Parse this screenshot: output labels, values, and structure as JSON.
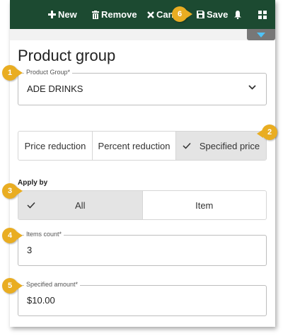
{
  "toolbar": {
    "new_label": "New",
    "remove_label": "Remove",
    "cancel_label": "Can",
    "save_label": "Save"
  },
  "page": {
    "title": "Product group"
  },
  "product_group": {
    "label": "Product Group*",
    "value": "ADE DRINKS"
  },
  "reduction_type": {
    "options": [
      "Price reduction",
      "Percent reduction",
      "Specified price"
    ],
    "selected": "Specified price"
  },
  "apply_by": {
    "heading": "Apply by",
    "options": [
      "All",
      "Item"
    ],
    "selected": "All"
  },
  "items_count": {
    "label": "Items count*",
    "value": "3"
  },
  "specified_amount": {
    "label": "Specified amount*",
    "value": "$10.00"
  },
  "callouts": [
    "1",
    "2",
    "3",
    "4",
    "5",
    "6"
  ],
  "colors": {
    "toolbar_bg": "#1c4a31",
    "callout": "#e9ad22",
    "collapse_tab": "#777777",
    "collapse_arrow": "#4fc3f7",
    "selected_segment": "#e4e4e4"
  },
  "icons": [
    "plus-icon",
    "trash-icon",
    "close-icon",
    "save-icon",
    "bell-icon",
    "grid-icon",
    "chevron-down-icon",
    "check-icon"
  ]
}
